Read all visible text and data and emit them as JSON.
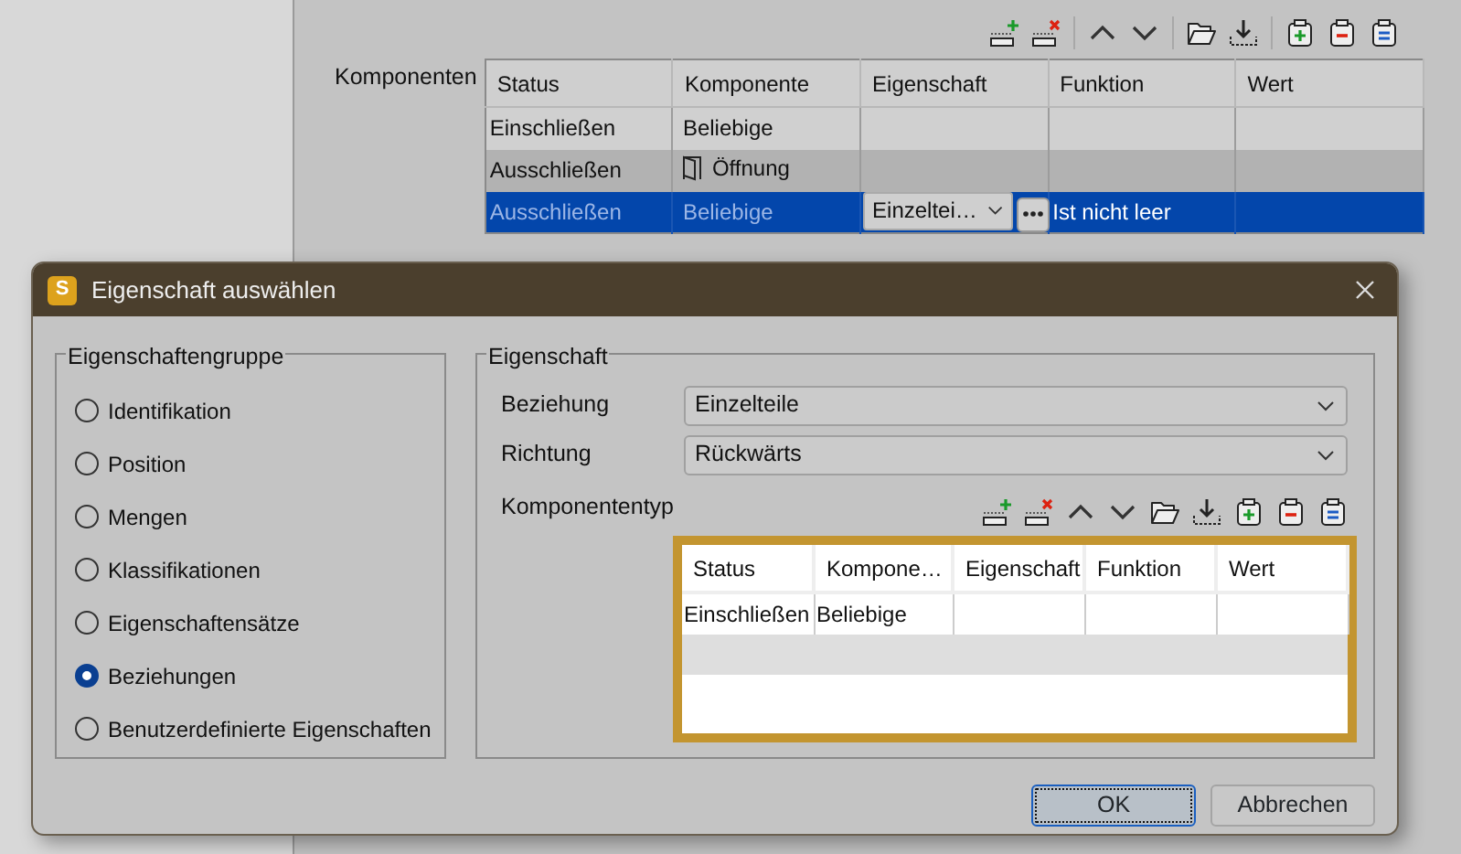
{
  "background": {
    "label": "Komponenten",
    "table": {
      "columns": [
        "Status",
        "Komponente",
        "Eigenschaft",
        "Funktion",
        "Wert"
      ],
      "rows": [
        {
          "selected": false,
          "cells": [
            {
              "text": "Einschließen"
            },
            {
              "text": "Beliebige"
            },
            null,
            null,
            null
          ]
        },
        {
          "selected": false,
          "cells": [
            {
              "text": "Ausschließen"
            },
            {
              "text": "Öffnung",
              "kind": "door"
            },
            null,
            null,
            null
          ]
        },
        {
          "selected": true,
          "cells": [
            {
              "text": "Ausschließen"
            },
            {
              "text": "Beliebige"
            },
            {
              "text": "Einzeltei…",
              "kind": "dropdown"
            },
            {
              "text": "Ist nicht leer"
            },
            null
          ]
        }
      ]
    }
  },
  "dialog": {
    "app_icon_letter": "S",
    "title": "Eigenschaft auswählen",
    "group": {
      "title": "Eigenschaftengruppe",
      "options": [
        {
          "label": "Identifikation",
          "selected": false
        },
        {
          "label": "Position",
          "selected": false
        },
        {
          "label": "Mengen",
          "selected": false
        },
        {
          "label": "Klassifikationen",
          "selected": false
        },
        {
          "label": "Eigenschaftensätze",
          "selected": false
        },
        {
          "label": "Beziehungen",
          "selected": true
        },
        {
          "label": "Benutzerdefinierte Eigenschaften",
          "selected": false
        }
      ]
    },
    "property": {
      "title": "Eigenschaft",
      "fields": [
        {
          "label": "Beziehung",
          "value": "Einzelteile"
        },
        {
          "label": "Richtung",
          "value": "Rückwärts"
        }
      ],
      "table_label": "Komponententyp",
      "table": {
        "columns": [
          "Status",
          "Kompone…",
          "Eigenschaft",
          "Funktion",
          "Wert"
        ],
        "rows": [
          {
            "cells": [
              "Einschließen",
              "Beliebige",
              null,
              null,
              null
            ]
          }
        ]
      }
    },
    "buttons": [
      {
        "label": "OK",
        "default": true
      },
      {
        "label": "Abbrechen",
        "default": false
      }
    ]
  }
}
